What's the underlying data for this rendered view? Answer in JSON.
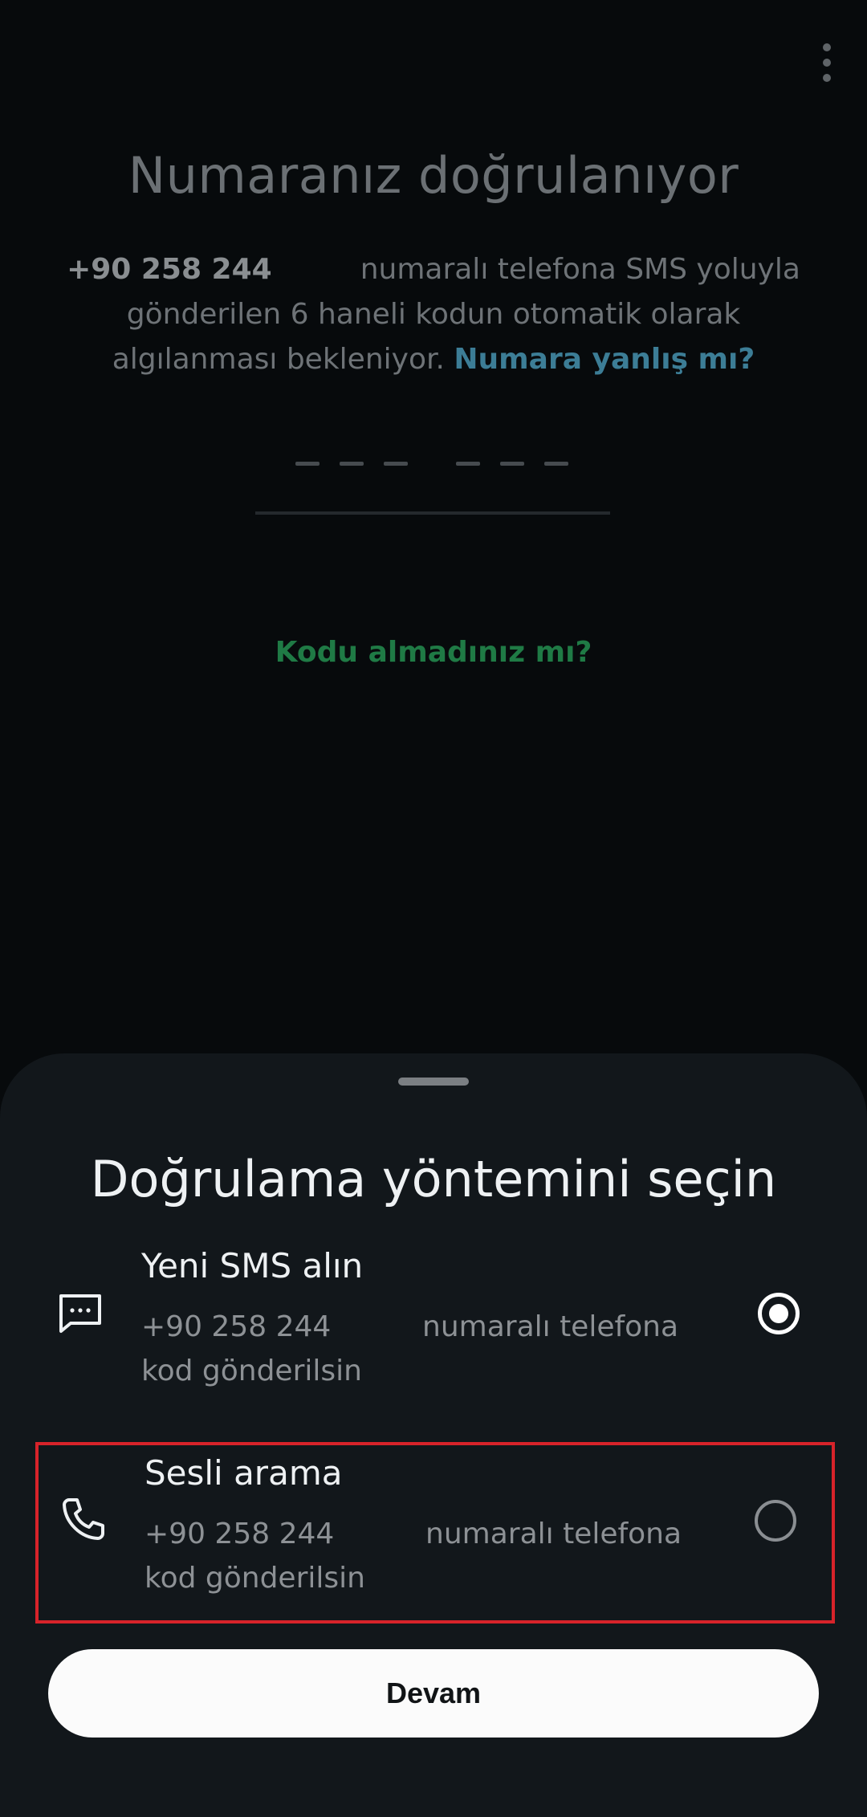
{
  "header": {
    "title": "Numaranız doğrulanıyor",
    "menu_icon": "more-vert-icon"
  },
  "description": {
    "phone": "+90 258 244",
    "text_1": "numaralı telefona SMS yoluyla gönderilen 6 haneli kodun otomatik olarak algılanması bekleniyor.",
    "wrong_number_link": "Numara yanlış mı?"
  },
  "code_input": {
    "digits": 6,
    "value": ""
  },
  "resend": {
    "label": "Kodu almadınız mı?"
  },
  "sheet": {
    "title": "Doğrulama yöntemini seçin",
    "options": [
      {
        "title": "Yeni SMS alın",
        "phone": "+90 258 244",
        "line_1_suffix": "numaralı telefona",
        "line_2": "kod gönderilsin",
        "icon": "sms-icon",
        "selected": true
      },
      {
        "title": "Sesli arama",
        "phone": "+90 258 244",
        "line_1_suffix": "numaralı telefona",
        "line_2": "kod gönderilsin",
        "icon": "phone-icon",
        "selected": false
      }
    ],
    "continue_label": "Devam"
  },
  "colors": {
    "background": "#070a0c",
    "sheet": "#12171b",
    "link_blue": "#3c7d96",
    "link_green": "#1f7a45",
    "highlight_red": "#d7232a"
  }
}
